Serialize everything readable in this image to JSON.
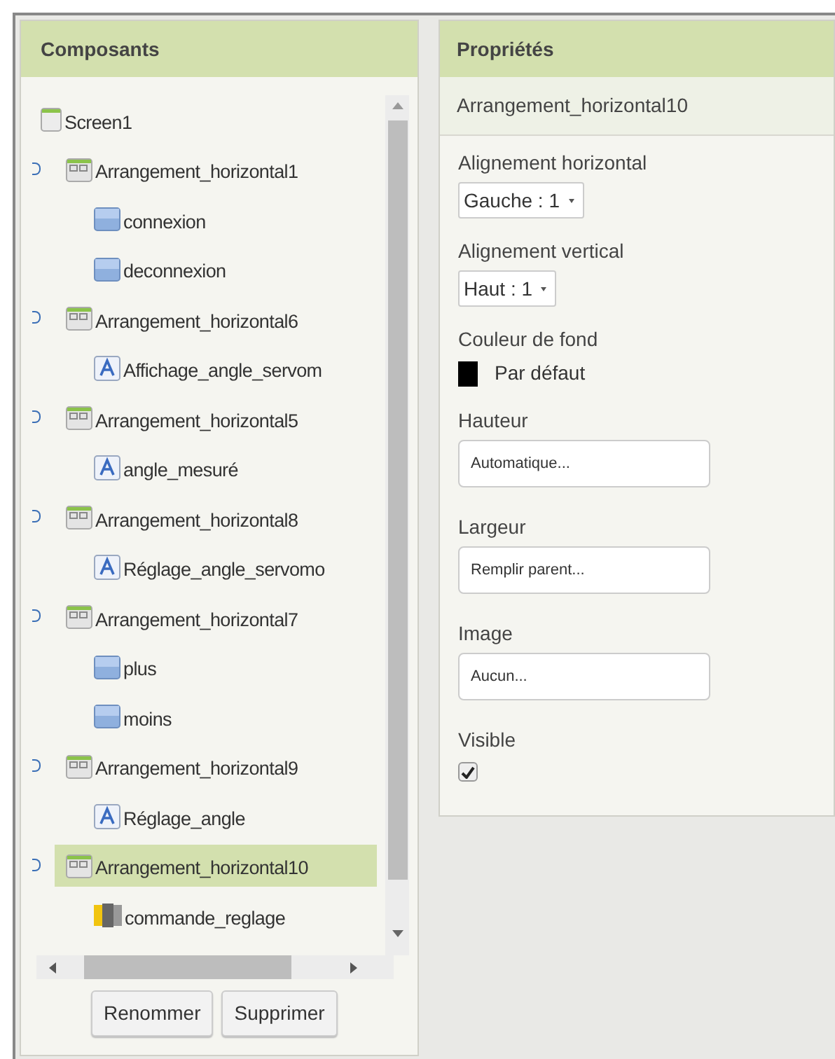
{
  "components": {
    "title": "Composants",
    "tree": [
      {
        "label": "Screen1",
        "kind": "screen",
        "selected": false,
        "children": [
          {
            "label": "Arrangement_horizontal1",
            "kind": "arrangement",
            "selected": false,
            "expanded": true,
            "children": [
              {
                "label": "connexion",
                "kind": "button",
                "selected": false
              },
              {
                "label": "deconnexion",
                "kind": "button",
                "selected": false
              }
            ]
          },
          {
            "label": "Arrangement_horizontal6",
            "kind": "arrangement",
            "selected": false,
            "expanded": true,
            "children": [
              {
                "label": "Affichage_angle_servom",
                "kind": "label",
                "selected": false
              }
            ]
          },
          {
            "label": "Arrangement_horizontal5",
            "kind": "arrangement",
            "selected": false,
            "expanded": true,
            "children": [
              {
                "label": "angle_mesuré",
                "kind": "label",
                "selected": false
              }
            ]
          },
          {
            "label": "Arrangement_horizontal8",
            "kind": "arrangement",
            "selected": false,
            "expanded": true,
            "children": [
              {
                "label": "Réglage_angle_servomo",
                "kind": "label",
                "selected": false
              }
            ]
          },
          {
            "label": "Arrangement_horizontal7",
            "kind": "arrangement",
            "selected": false,
            "expanded": true,
            "children": [
              {
                "label": "plus",
                "kind": "button",
                "selected": false
              },
              {
                "label": "moins",
                "kind": "button",
                "selected": false
              }
            ]
          },
          {
            "label": "Arrangement_horizontal9",
            "kind": "arrangement",
            "selected": false,
            "expanded": true,
            "children": [
              {
                "label": "Réglage_angle",
                "kind": "label",
                "selected": false
              }
            ]
          },
          {
            "label": "Arrangement_horizontal10",
            "kind": "arrangement",
            "selected": true,
            "expanded": true,
            "children": [
              {
                "label": "commande_reglage",
                "kind": "slider",
                "selected": false
              }
            ]
          }
        ]
      }
    ],
    "buttons": [
      "Renommer",
      "Supprimer"
    ]
  },
  "properties": {
    "title": "Propriétés",
    "component": "Arrangement_horizontal10",
    "items": [
      {
        "label": "Alignement horizontal",
        "kind": "dropdown",
        "value": "Gauche : 1"
      },
      {
        "label": "Alignement vertical",
        "kind": "dropdown",
        "value": "Haut : 1"
      },
      {
        "label": "Couleur de fond",
        "kind": "color",
        "value": "Par défaut",
        "color": "#000000"
      },
      {
        "label": "Hauteur",
        "kind": "textbox",
        "value": "Automatique..."
      },
      {
        "label": "Largeur",
        "kind": "textbox",
        "value": "Remplir parent..."
      },
      {
        "label": "Image",
        "kind": "textbox",
        "value": "Aucun..."
      },
      {
        "label": "Visible",
        "kind": "checkbox",
        "checked": true
      }
    ]
  }
}
